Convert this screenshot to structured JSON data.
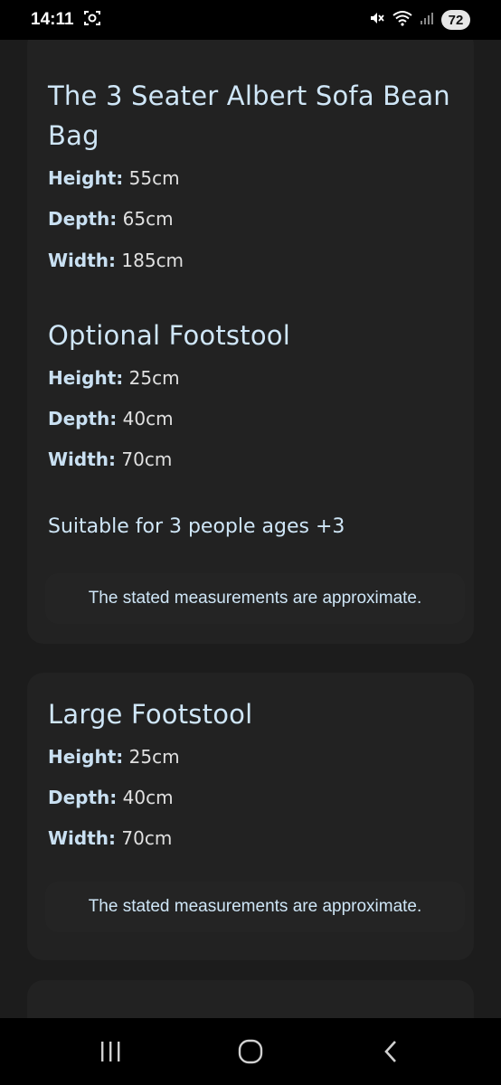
{
  "status_bar": {
    "time": "14:11",
    "battery": "72"
  },
  "sections": {
    "sofa": {
      "title_line1": "The 3 Seater Albert Sofa Bean",
      "title_line2": "Bag",
      "height_label": "Height:",
      "height_value": " 55cm",
      "depth_label": "Depth:",
      "depth_value": " 65cm",
      "width_label": "Width:",
      "width_value": " 185cm"
    },
    "optional_footstool": {
      "title": "Optional Footstool",
      "height_label": "Height:",
      "height_value": " 25cm",
      "depth_label": "Depth:",
      "depth_value": " 40cm",
      "width_label": "Width:",
      "width_value": " 70cm"
    },
    "suitable": "Suitable for 3 people ages +3",
    "note1": "The stated measurements are approximate.",
    "large_footstool": {
      "title": "Large Footstool",
      "height_label": "Height:",
      "height_value": " 25cm",
      "depth_label": "Depth:",
      "depth_value": " 40cm",
      "width_label": "Width:",
      "width_value": " 70cm"
    },
    "note2": "The stated measurements are approximate."
  },
  "icons": {
    "screenshot": "screenshot-icon",
    "mute": "mute-icon",
    "wifi": "wifi-icon",
    "signal": "signal-icon",
    "recents": "recents-icon",
    "home": "home-icon",
    "back": "back-icon"
  }
}
